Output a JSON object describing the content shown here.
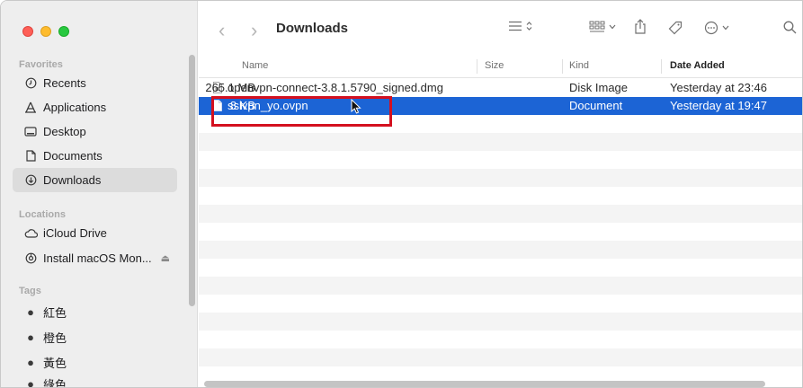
{
  "window": {
    "title": "Downloads"
  },
  "sidebar": {
    "favorites_label": "Favorites",
    "favorites": [
      {
        "label": "Recents",
        "icon": "clock-icon"
      },
      {
        "label": "Applications",
        "icon": "applications-icon"
      },
      {
        "label": "Desktop",
        "icon": "desktop-icon"
      },
      {
        "label": "Documents",
        "icon": "document-icon"
      },
      {
        "label": "Downloads",
        "icon": "download-icon",
        "active": true
      }
    ],
    "locations_label": "Locations",
    "locations": [
      {
        "label": "iCloud Drive",
        "icon": "cloud-icon"
      },
      {
        "label": "Install macOS Mon...",
        "icon": "disk-icon",
        "eject": "⏏"
      }
    ],
    "tags_label": "Tags",
    "tags": [
      {
        "label": "紅色"
      },
      {
        "label": "橙色"
      },
      {
        "label": "黃色"
      },
      {
        "label": "綠色"
      }
    ]
  },
  "columns": {
    "name": "Name",
    "size": "Size",
    "kind": "Kind",
    "date": "Date Added"
  },
  "files": [
    {
      "name": "openvpn-connect-3.8.1.5790_signed.dmg",
      "size": "265.1 MB",
      "kind": "Disk Image",
      "date": "Yesterday at 23:46"
    },
    {
      "name": "sslvpn_yo.ovpn",
      "size": "8 KB",
      "kind": "Document",
      "date": "Yesterday at 19:47",
      "selected": true
    }
  ],
  "colors": {
    "selection": "#1c64d5",
    "highlight_box": "#d4101f"
  }
}
